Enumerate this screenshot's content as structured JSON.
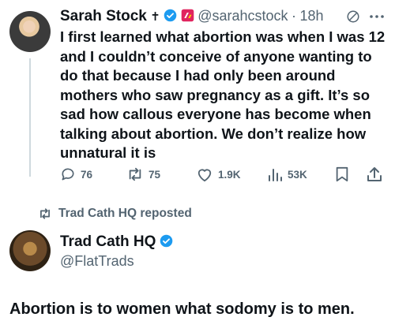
{
  "tweet1": {
    "author_name": "Sarah Stock",
    "name_suffix": "✝",
    "handle": "@sarahcstock",
    "separator": "·",
    "time": "18h",
    "text": "I first learned what abortion was when I was 12 and I couldn’t conceive of anyone wanting to do that because I had only been around mothers who saw pregnancy as a gift. It’s so sad how callous everyone has become when talking about abortion. We don’t realize how unnatural it is",
    "replies": "76",
    "reposts": "75",
    "likes": "1.9K",
    "views": "53K"
  },
  "repost_banner": "Trad Cath HQ reposted",
  "tweet2": {
    "author_name": "Trad Cath HQ",
    "handle": "@FlatTrads"
  },
  "caption": "Abortion is to women what sodomy is to men.",
  "colors": {
    "verified_blue": "#1d9bf0",
    "muted": "#536471",
    "text": "#0f1419",
    "badge_red": "#e0245e"
  },
  "icons": [
    "verified-icon",
    "brand-badge-icon",
    "grok-icon",
    "more-icon",
    "reply-icon",
    "repost-icon",
    "like-icon",
    "views-icon",
    "bookmark-icon",
    "share-icon"
  ]
}
